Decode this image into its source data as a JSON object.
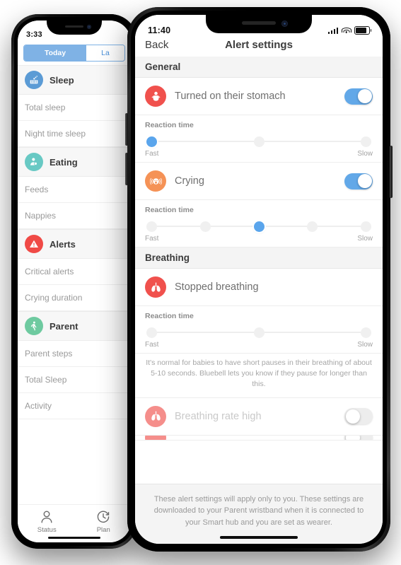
{
  "left_phone": {
    "status_bar": {
      "time": "3:33"
    },
    "segmented": {
      "tabs": [
        {
          "label": "Today",
          "active": true
        },
        {
          "label": "La",
          "active": false
        }
      ]
    },
    "list": [
      {
        "type": "group",
        "icon": "crib-icon",
        "label": "Sleep",
        "color": "#5b9bd5"
      },
      {
        "type": "item",
        "label": "Total sleep"
      },
      {
        "type": "item",
        "label": "Night time sleep"
      },
      {
        "type": "group",
        "icon": "feeding-icon",
        "label": "Eating",
        "color": "#68c9c4"
      },
      {
        "type": "item",
        "label": "Feeds"
      },
      {
        "type": "item",
        "label": "Nappies"
      },
      {
        "type": "group",
        "icon": "warning-icon",
        "label": "Alerts",
        "color": "#f04a46"
      },
      {
        "type": "item",
        "label": "Critical alerts"
      },
      {
        "type": "item",
        "label": "Crying duration"
      },
      {
        "type": "group",
        "icon": "walking-icon",
        "label": "Parent",
        "color": "#6ecaa0"
      },
      {
        "type": "item",
        "label": "Parent steps"
      },
      {
        "type": "item",
        "label": "Total Sleep"
      },
      {
        "type": "item",
        "label": "Activity"
      }
    ],
    "tab_bar": [
      {
        "icon": "person-icon",
        "label": "Status"
      },
      {
        "icon": "clock-history-icon",
        "label": "Plan"
      }
    ]
  },
  "right_phone": {
    "status_bar": {
      "time": "11:40"
    },
    "nav": {
      "back_label": "Back",
      "title": "Alert settings"
    },
    "sections": [
      {
        "header": "General",
        "alerts": [
          {
            "icon": "baby-stomach-icon",
            "icon_color": "#f0514d",
            "label": "Turned on their stomach",
            "toggle": "on",
            "enabled": true,
            "reaction": {
              "label": "Reaction time",
              "steps": 3,
              "selected": 1,
              "fast_label": "Fast",
              "slow_label": "Slow"
            }
          },
          {
            "icon": "crying-icon",
            "icon_color": "#f59256",
            "label": "Crying",
            "toggle": "on",
            "enabled": true,
            "reaction": {
              "label": "Reaction time",
              "steps": 5,
              "selected": 3,
              "fast_label": "Fast",
              "slow_label": "Slow"
            }
          }
        ]
      },
      {
        "header": "Breathing",
        "alerts": [
          {
            "icon": "lungs-icon",
            "icon_color": "#f0514d",
            "label": "Stopped breathing",
            "toggle": "none",
            "enabled": true,
            "reaction": {
              "label": "Reaction time",
              "steps": 3,
              "selected": 0,
              "fast_label": "Fast",
              "slow_label": "Slow"
            },
            "note": "It's normal for babies to have short pauses in their breathing of about 5-10 seconds. Bluebell lets you know if they pause for longer than this."
          },
          {
            "icon": "lungs-icon",
            "icon_color": "#f58e8b",
            "label": "Breathing rate high",
            "toggle": "off",
            "enabled": false
          }
        ]
      }
    ],
    "footer_note": "These alert settings will apply only to you. These settings are downloaded to your Parent wristband when it is connected to your Smart hub and you are set as wearer."
  }
}
